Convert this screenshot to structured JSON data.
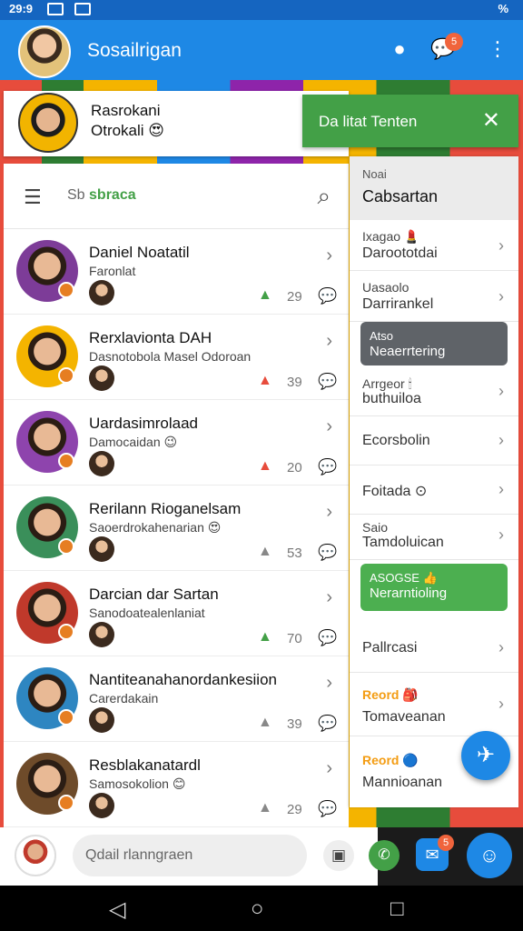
{
  "status_bar": {
    "time": "29:9",
    "right": "%"
  },
  "app_bar": {
    "title": "Sosailrigan",
    "notification_count": "5"
  },
  "profile": {
    "name": "Rasrokani",
    "subtitle": "Otrokali 😍"
  },
  "snackbar": {
    "text": "Da litat Tenten"
  },
  "search": {
    "prefix": "Sb ",
    "highlight": "sbraca"
  },
  "contacts": [
    {
      "name": "Daniel Noatatil",
      "sub": "Faronlat",
      "count": "29",
      "like_color": "#43a047",
      "avatar_color": "#7d3c98"
    },
    {
      "name": "Rerxlavionta DAH",
      "sub": "Dasnotobola Masel Odoroan",
      "count": "39",
      "like_color": "#e74c3c",
      "avatar_color": "#f4b400"
    },
    {
      "name": "Uardasimrolaad",
      "sub": "Damocaidan 😉",
      "count": "20",
      "like_color": "#e74c3c",
      "avatar_color": "#8e44ad"
    },
    {
      "name": "Rerilann Rioganelsam",
      "sub": "Saoerdrokahenarian 😍",
      "count": "53",
      "like_color": "#888888",
      "avatar_color": "#3a8f5a"
    },
    {
      "name": "Darcian dar Sartan",
      "sub": "Sanodoatealenlaniat",
      "count": "70",
      "like_color": "#43a047",
      "avatar_color": "#c0392b"
    },
    {
      "name": "Nantiteanahanordankesiion",
      "sub": "Carerdakain",
      "count": "39",
      "like_color": "#888888",
      "avatar_color": "#2e86c1"
    },
    {
      "name": "Resblakanatardl",
      "sub": "Samosokolion 😊",
      "count": "29",
      "like_color": "#888888",
      "avatar_color": "#6e4b2a"
    }
  ],
  "menu": {
    "header_small": "Noai",
    "header_title": "Cabsartan",
    "items": [
      {
        "a": "Ixagao 💄",
        "b": "Daroototdai"
      },
      {
        "a": "Uasaolo",
        "b": "Darrirankel"
      },
      {
        "a": "Arrgeor 🕯",
        "b": "buthuiloa"
      },
      {
        "b": "Ecorsbolin"
      },
      {
        "b": "Foitada ⊙"
      },
      {
        "a": "Saio",
        "b": "Tamdoluican"
      },
      {
        "b": "Pallrcasi"
      },
      {
        "a": "Reord 🎒",
        "b": "Tomaveanan"
      },
      {
        "a": "Reord 🔵",
        "b": "Mannioanan"
      }
    ],
    "dark_button": {
      "a": "Atso",
      "b": "Neaerrtering"
    },
    "green_button": {
      "a": "ASOGSE 👍",
      "b": "Nerarntioling"
    }
  },
  "composer": {
    "placeholder": "Qdail rlanngraen"
  },
  "icons": {
    "status": "signal-icons",
    "app_bar": [
      "palette-icon",
      "chat-icon",
      "more-icon"
    ],
    "nav": [
      "back-icon",
      "home-icon",
      "recent-icon"
    ]
  },
  "colors": {
    "primary": "#1e88e5",
    "accent": "#43a047",
    "badge": "#f0643c"
  }
}
